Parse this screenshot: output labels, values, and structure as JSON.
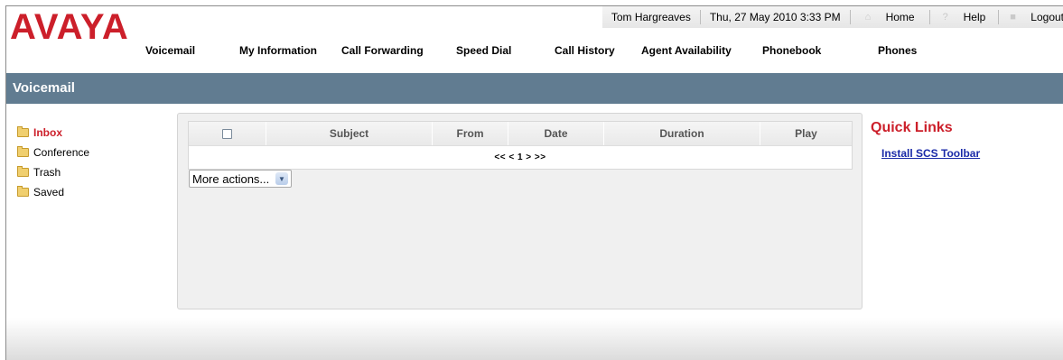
{
  "brand": {
    "logo_text": "AVAYA",
    "logo_color": "#cc1f2a"
  },
  "topbar": {
    "user_name": "Tom Hargreaves",
    "datetime": "Thu, 27 May 2010 3:33 PM",
    "home_label": "Home",
    "help_label": "Help",
    "logout_label": "Logout"
  },
  "nav": {
    "items": [
      {
        "label": "Voicemail"
      },
      {
        "label": "My Information"
      },
      {
        "label": "Call Forwarding"
      },
      {
        "label": "Speed Dial"
      },
      {
        "label": "Call History"
      },
      {
        "label": "Agent Availability"
      },
      {
        "label": "Phonebook"
      },
      {
        "label": "Phones"
      }
    ]
  },
  "banner": {
    "title": "Voicemail",
    "color": "#617c91"
  },
  "folders": [
    {
      "label": "Inbox",
      "active": true
    },
    {
      "label": "Conference",
      "active": false
    },
    {
      "label": "Trash",
      "active": false
    },
    {
      "label": "Saved",
      "active": false
    }
  ],
  "table": {
    "columns": [
      "Subject",
      "From",
      "Date",
      "Duration",
      "Play"
    ],
    "pager": "<< < 1 > >>"
  },
  "more_actions": {
    "value": "More actions..."
  },
  "quick_links": {
    "title": "Quick Links",
    "links": [
      {
        "label": "Install SCS Toolbar"
      }
    ]
  }
}
